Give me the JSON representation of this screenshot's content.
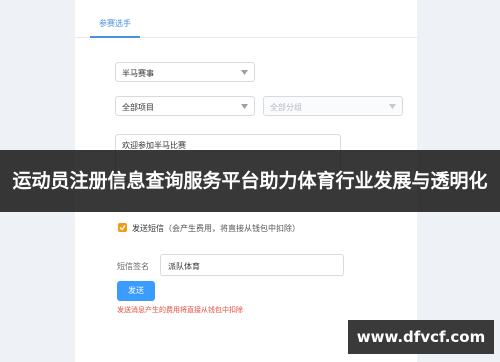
{
  "tabs": {
    "active_label": "参赛选手"
  },
  "form": {
    "event_select": {
      "value": "半马赛事"
    },
    "project_select": {
      "value": "全部项目"
    },
    "group_select": {
      "value": "全部分组"
    },
    "message": {
      "value": "欢迎参加半马比赛"
    },
    "sms": {
      "label": "发送短信",
      "note": "（会产生费用，将直接从钱包中扣除）",
      "checked": true
    },
    "signature": {
      "label": "短信签名",
      "value": "派队体育"
    },
    "send_button": {
      "label": "发送"
    },
    "warning": "发送消息产生的费用将直接从钱包中扣除"
  },
  "banner": {
    "text": "运动员注册信息查询服务平台助力体育行业发展与透明化"
  },
  "watermark": {
    "text": "www.dfvcf.com"
  },
  "colors": {
    "accent": "#4a90e2",
    "button": "#3b9cff",
    "checkbox": "#f39c12",
    "warning": "#e74c3c"
  }
}
